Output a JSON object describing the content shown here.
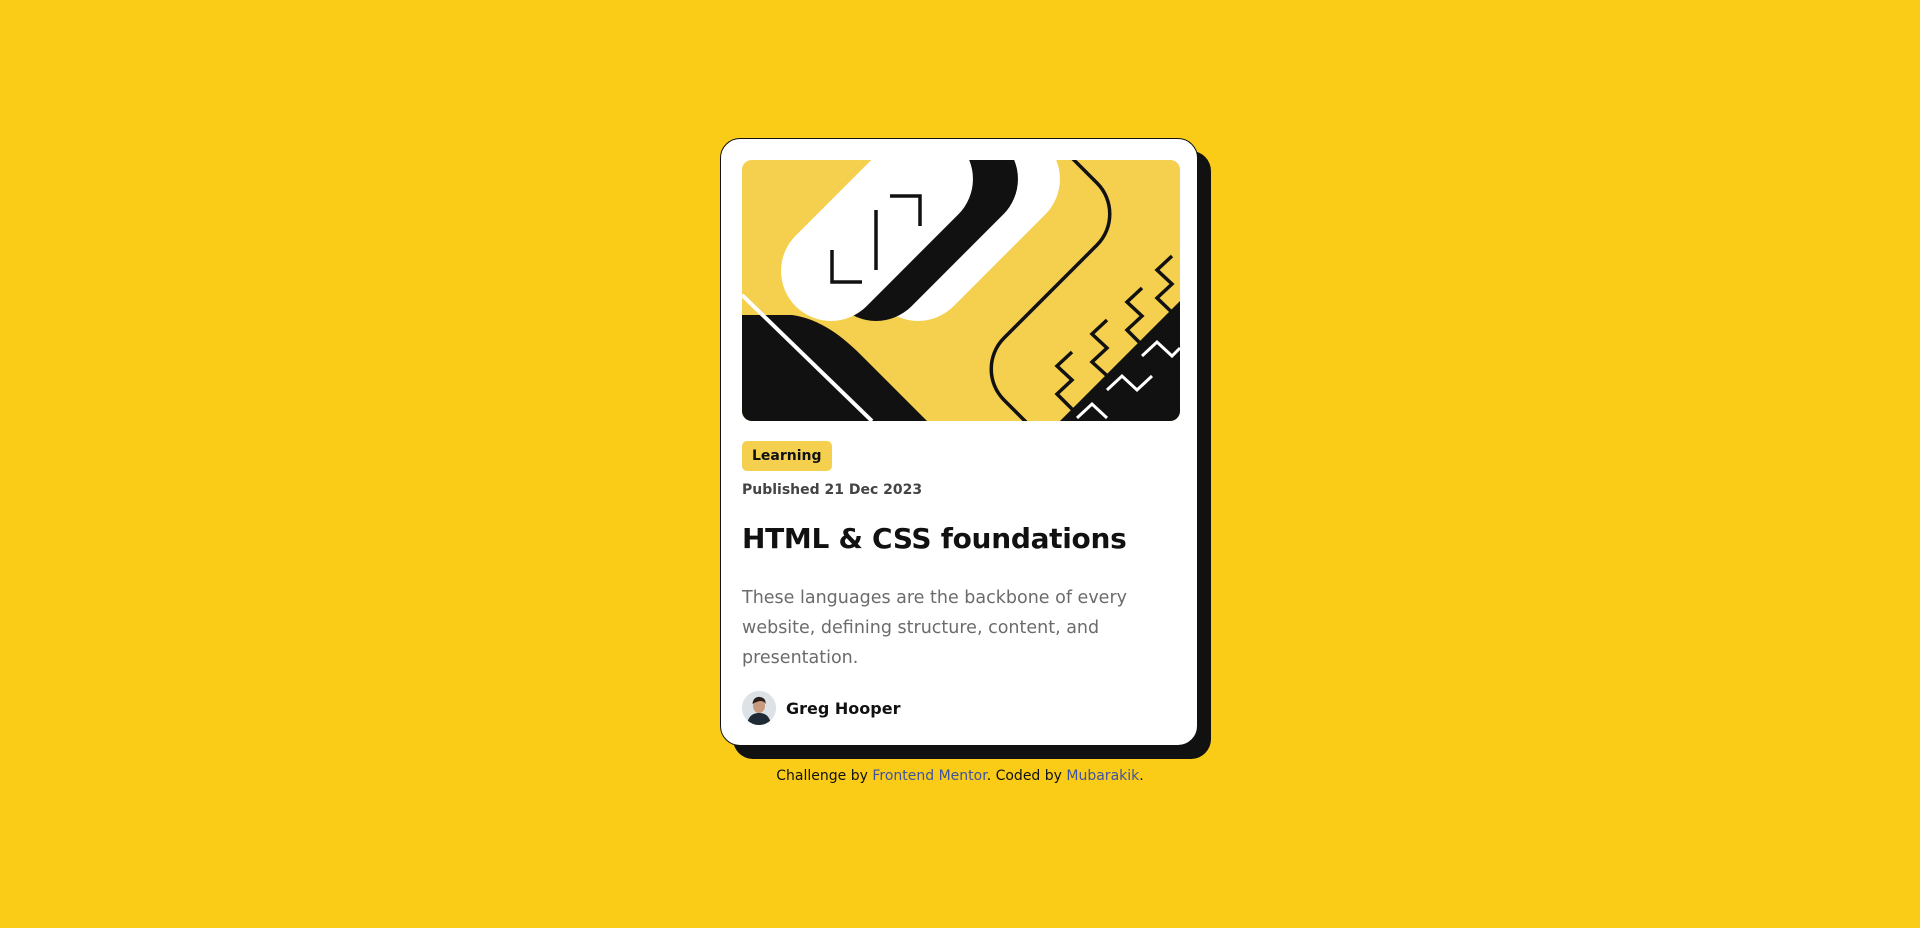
{
  "card": {
    "tag": "Learning",
    "published": "Published 21 Dec 2023",
    "title": "HTML & CSS foundations",
    "description": "These languages are the backbone of every website, defining structure, content, and presentation.",
    "author": {
      "name": "Greg Hooper",
      "avatar_icon": "avatar-photo-icon"
    },
    "hero_illustration": "abstract-geometric-illustration"
  },
  "attribution": {
    "prefix": "Challenge by ",
    "link1": "Frontend Mentor",
    "middle": ". Coded by ",
    "link2": "Mubarakik",
    "suffix": "."
  },
  "colors": {
    "background": "#FACC17",
    "card": "#FFFFFF",
    "shadow": "#111111",
    "tag_bg": "#F4D04E",
    "link": "#3E52A3",
    "text_muted": "#6B6B6B"
  }
}
